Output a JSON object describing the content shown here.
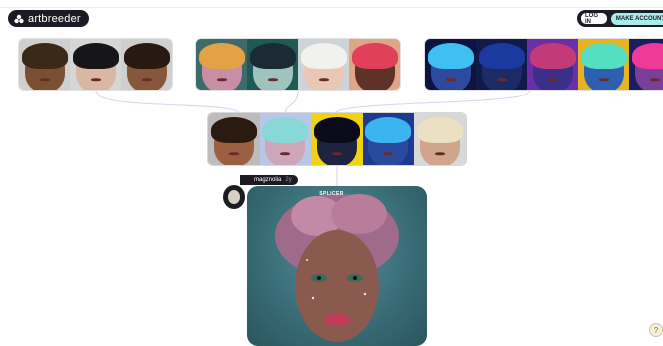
{
  "header": {
    "logo_text": "artbreeder",
    "login_label": "LOG IN",
    "make_account_label": "MAKE ACCOUNT"
  },
  "parents": [
    {
      "group": "parent-group-1",
      "thumbs": [
        {
          "bg": "#cfcfcf",
          "skin": "#7a5035",
          "hair": "#3a2818"
        },
        {
          "bg": "#d6d6d6",
          "skin": "#d9b7a2",
          "hair": "#16161a"
        },
        {
          "bg": "#cfcfcf",
          "skin": "#86573a",
          "hair": "#281a12"
        }
      ]
    },
    {
      "group": "parent-group-2",
      "thumbs": [
        {
          "bg": "#3d6b6a",
          "skin": "#c88ea6",
          "hair": "#e4a246"
        },
        {
          "bg": "#1f5a55",
          "skin": "#9fc3bd",
          "hair": "#1b2a34"
        },
        {
          "bg": "#cdd3d6",
          "skin": "#e8c7b5",
          "hair": "#f1f1ee"
        },
        {
          "bg": "#e0a487",
          "skin": "#5c3326",
          "hair": "#e0405a"
        }
      ]
    },
    {
      "group": "parent-group-3",
      "thumbs": [
        {
          "bg": "#0c1440",
          "skin": "#2d4a9e",
          "hair": "#3fc0f2"
        },
        {
          "bg": "#111a4a",
          "skin": "#1c2a66",
          "hair": "#1a3aa0"
        },
        {
          "bg": "#6a2fa8",
          "skin": "#3a2f8a",
          "hair": "#c23a78"
        },
        {
          "bg": "#e6b420",
          "skin": "#2f5fb0",
          "hair": "#54e0c0"
        },
        {
          "bg": "#1a1e5e",
          "skin": "#7a3f98",
          "hair": "#f03a9a"
        }
      ]
    }
  ],
  "children": [
    {
      "bg": "#bcbcbc",
      "skin": "#9a6040",
      "hair": "#2a1a10"
    },
    {
      "bg": "#b8c6e8",
      "skin": "#cfa6b8",
      "hair": "#88d8d8"
    },
    {
      "bg": "#f1d20e",
      "skin": "#1e2440",
      "hair": "#0a0a1a"
    },
    {
      "bg": "#1e3a90",
      "skin": "#2a4a9e",
      "hair": "#3cb4f0"
    },
    {
      "bg": "#d8d8d8",
      "skin": "#cfa58c",
      "hair": "#ece0c2"
    }
  ],
  "user": {
    "name": "magznolia",
    "age": "2y"
  },
  "main_card": {
    "label": "SPLICER"
  },
  "help": {
    "symbol": "?"
  }
}
